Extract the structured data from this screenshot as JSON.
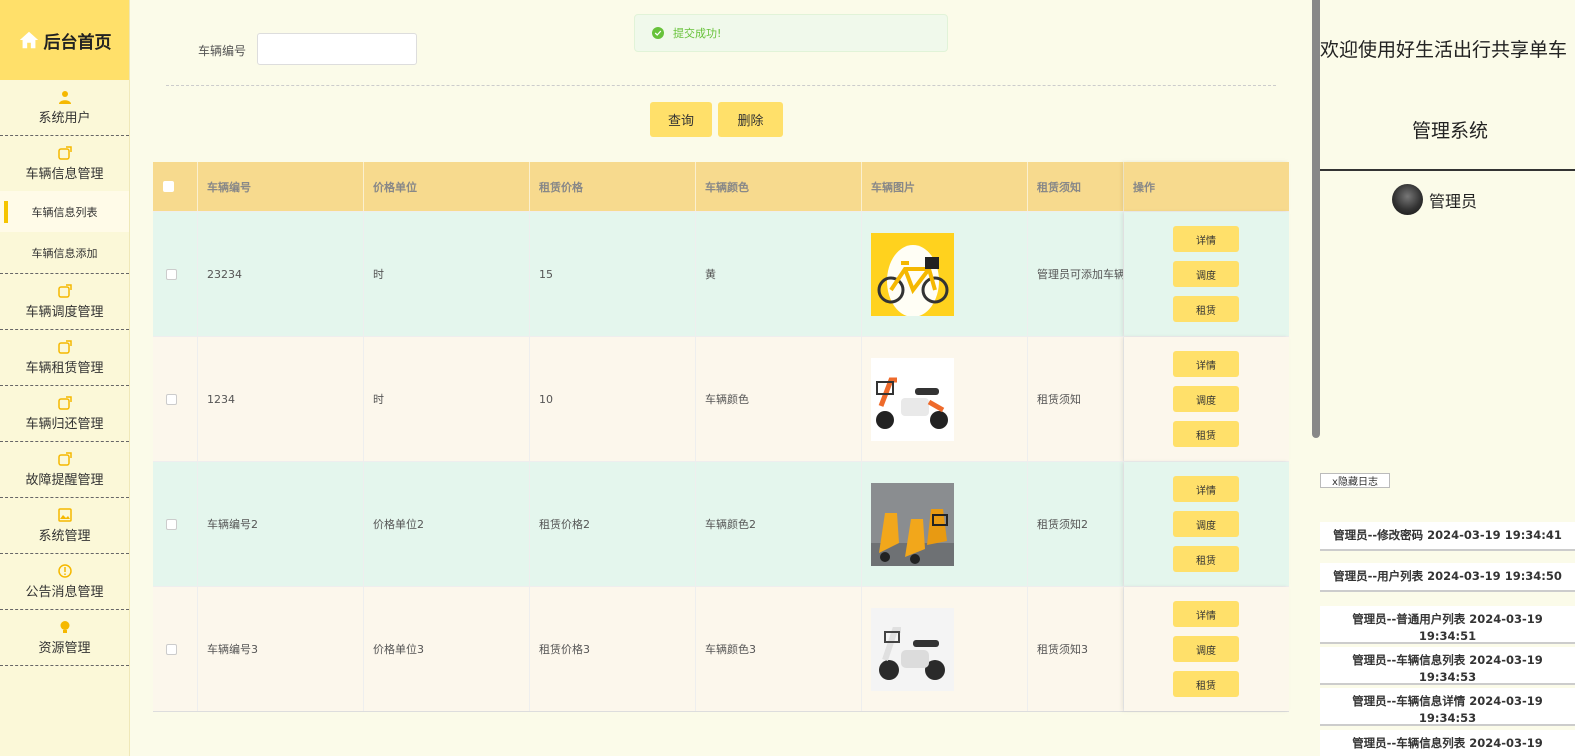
{
  "brand": {
    "label": "后台首页",
    "icon": "home-icon"
  },
  "sidebar": {
    "items": [
      {
        "label": "系统用户",
        "icon": "user-icon"
      },
      {
        "label": "车辆信息管理",
        "icon": "edit-icon"
      },
      {
        "label": "车辆调度管理",
        "icon": "edit-icon"
      },
      {
        "label": "车辆租赁管理",
        "icon": "edit-icon"
      },
      {
        "label": "车辆归还管理",
        "icon": "edit-icon"
      },
      {
        "label": "故障提醒管理",
        "icon": "edit-icon"
      },
      {
        "label": "系统管理",
        "icon": "picture-icon"
      },
      {
        "label": "公告消息管理",
        "icon": "info-icon"
      },
      {
        "label": "资源管理",
        "icon": "bulb-icon"
      }
    ],
    "subitems": [
      {
        "label": "车辆信息列表",
        "active": true
      },
      {
        "label": "车辆信息添加",
        "active": false
      }
    ]
  },
  "search": {
    "label": "车辆编号",
    "value": ""
  },
  "toast": {
    "message": "提交成功!",
    "color": "#67c23a"
  },
  "buttons": {
    "query": "查询",
    "delete": "删除"
  },
  "table": {
    "headers": [
      "车辆编号",
      "价格单位",
      "租赁价格",
      "车辆颜色",
      "车辆图片",
      "租赁须知",
      "操作"
    ],
    "actions": [
      "详情",
      "调度",
      "租赁"
    ],
    "rows": [
      {
        "id": "23234",
        "unit": "时",
        "price": "15",
        "color": "黄",
        "image": "yellow-bicycle-image",
        "notice": "管理员可添加车辆"
      },
      {
        "id": "1234",
        "unit": "时",
        "price": "10",
        "color": "车辆颜色",
        "image": "orange-white-ebike-image",
        "notice": "租赁须知"
      },
      {
        "id": "车辆编号2",
        "unit": "价格单位2",
        "price": "租赁价格2",
        "color": "车辆颜色2",
        "image": "orange-scooters-image",
        "notice": "租赁须知2"
      },
      {
        "id": "车辆编号3",
        "unit": "价格单位3",
        "price": "租赁价格3",
        "color": "车辆颜色3",
        "image": "white-ebike-image",
        "notice": "租赁须知3"
      }
    ]
  },
  "right_panel": {
    "welcome": "欢迎使用好生活出行共享单车",
    "system": "管理系统",
    "user": "管理员",
    "hide_log": "x隐藏日志",
    "logs": [
      {
        "line1": "管理员--修改密码 2024-03-19 19:34:41",
        "line2": ""
      },
      {
        "line1": "管理员--用户列表 2024-03-19 19:34:50",
        "line2": ""
      },
      {
        "line1": "管理员--普通用户列表 2024-03-19",
        "line2": "19:34:51"
      },
      {
        "line1": "管理员--车辆信息列表 2024-03-19",
        "line2": "19:34:53"
      },
      {
        "line1": "管理员--车辆信息详情 2024-03-19",
        "line2": "19:34:53"
      },
      {
        "line1": "管理员--车辆信息列表 2024-03-19",
        "line2": ""
      }
    ]
  },
  "colors": {
    "accent": "#ffe06a",
    "header": "#f7da8e",
    "row_alt": "#e4f6ed",
    "row": "#fcf7ec",
    "sidebar": "#fbf8d8"
  }
}
